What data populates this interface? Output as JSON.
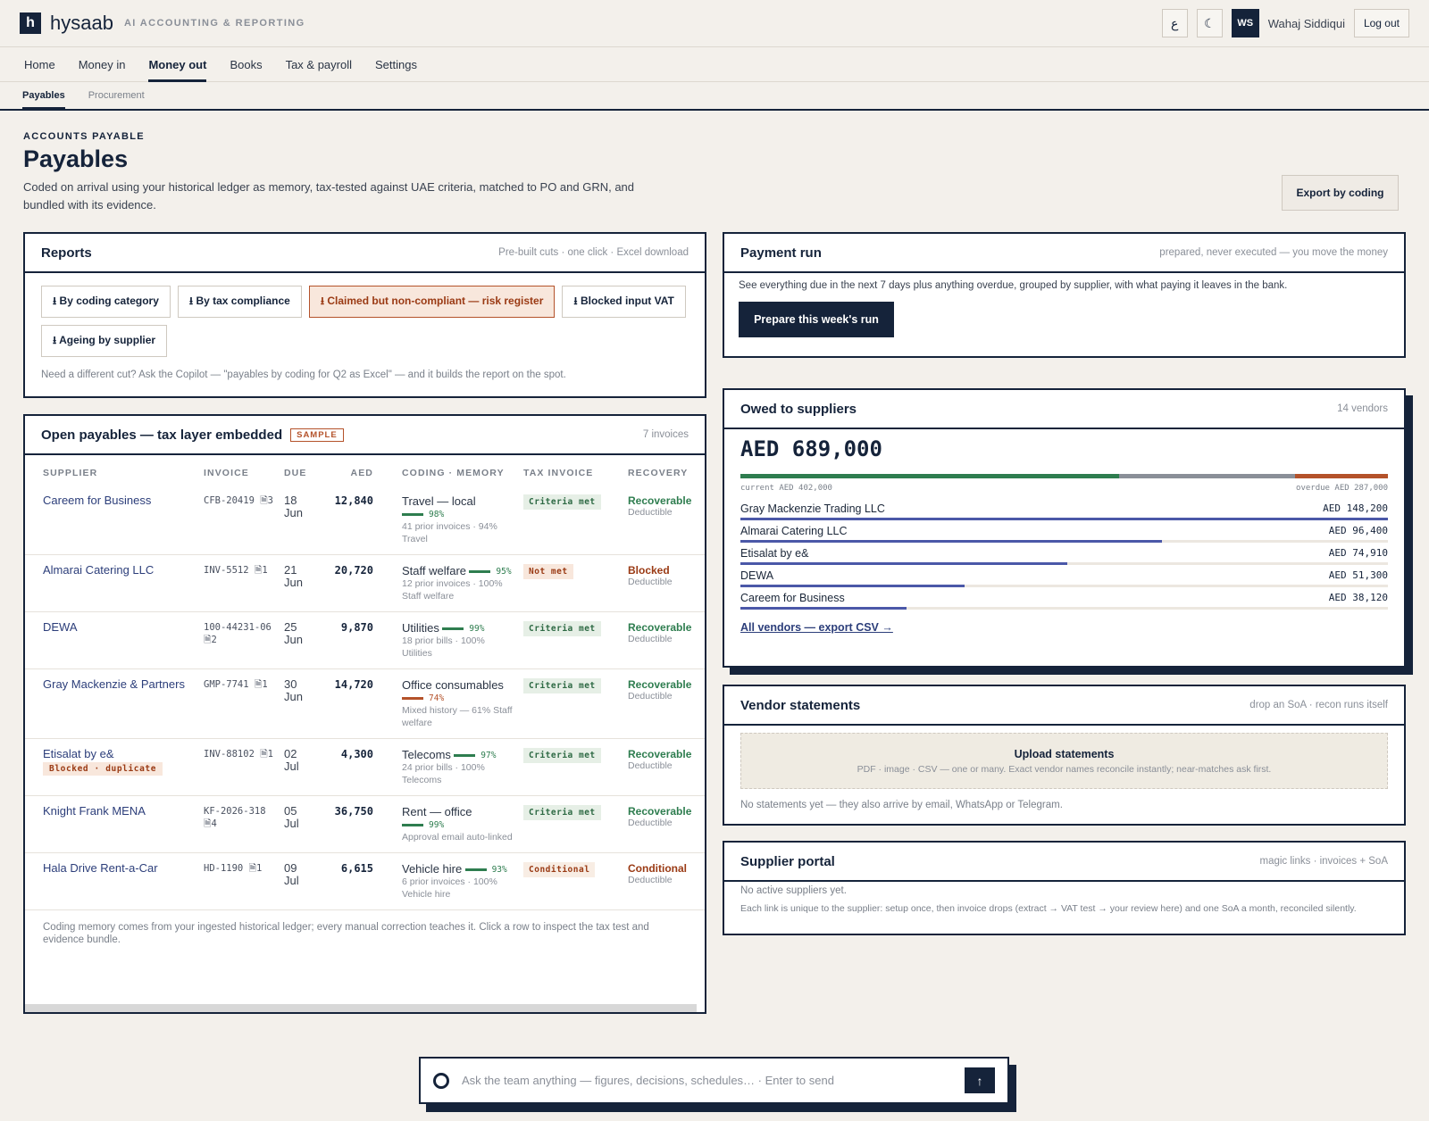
{
  "app": {
    "logo_letter": "h",
    "name": "hysaab",
    "tagline": "AI ACCOUNTING & REPORTING",
    "lang_glyph": "ع",
    "theme_glyph": "☾",
    "user_initials": "WS",
    "user_name": "Wahaj Siddiqui",
    "logout_label": "Log out"
  },
  "nav": {
    "items": [
      {
        "label": "Home"
      },
      {
        "label": "Money in"
      },
      {
        "label": "Money out"
      },
      {
        "label": "Books"
      },
      {
        "label": "Tax & payroll"
      },
      {
        "label": "Settings"
      }
    ],
    "sub": [
      {
        "label": "Payables"
      },
      {
        "label": "Procurement"
      }
    ]
  },
  "header": {
    "eyebrow": "ACCOUNTS PAYABLE",
    "title": "Payables",
    "description": "Coded on arrival using your historical ledger as memory, tax-tested against UAE criteria, matched to PO and GRN, and bundled with its evidence.",
    "export_label": "Export by coding"
  },
  "reports": {
    "title": "Reports",
    "meta": "Pre-built cuts · one click · Excel download",
    "buttons": [
      "⭳ By coding category",
      "⭳ By tax compliance",
      "⭳ Claimed but non-compliant — risk register",
      "⭳ Blocked input VAT",
      "⭳ Ageing by supplier"
    ],
    "note": "Need a different cut? Ask the Copilot — \"payables by coding for Q2 as Excel\" — and it builds the report on the spot."
  },
  "payment_run": {
    "title": "Payment run",
    "meta": "prepared, never executed — you move the money",
    "text": "See everything due in the next 7 days plus anything overdue, grouped by supplier, with what paying it leaves in the bank.",
    "button": "Prepare this week's run"
  },
  "open_payables": {
    "title": "Open payables — tax layer embedded",
    "sample_tag": "SAMPLE",
    "meta": "7 invoices",
    "columns": [
      "SUPPLIER",
      "INVOICE",
      "DUE",
      "AED",
      "CODING · MEMORY",
      "TAX INVOICE",
      "RECOVERY"
    ],
    "rows": [
      {
        "supplier": "Careem for Business",
        "invoice": "CFB-20419",
        "attach": "🗎3",
        "due_day": "18",
        "due_mon": "Jun",
        "aed": "12,840",
        "coding": "Travel — local",
        "pct": "98%",
        "pct_value": 98,
        "memory": "41 prior invoices · 94% Travel",
        "tax": "Criteria met",
        "recovery": "Recoverable",
        "recovery_sub": "Deductible"
      },
      {
        "supplier": "Almarai Catering LLC",
        "invoice": "INV-5512",
        "attach": "🗎1",
        "due_day": "21",
        "due_mon": "Jun",
        "aed": "20,720",
        "coding": "Staff welfare",
        "pct": "95%",
        "pct_value": 95,
        "memory": "12 prior invoices · 100% Staff welfare",
        "tax": "Not met",
        "recovery": "Blocked",
        "recovery_sub": "Deductible"
      },
      {
        "supplier": "DEWA",
        "invoice": "100-44231-06",
        "attach": "🗎2",
        "due_day": "25",
        "due_mon": "Jun",
        "aed": "9,870",
        "coding": "Utilities",
        "pct": "99%",
        "pct_value": 99,
        "memory": "18 prior bills · 100% Utilities",
        "tax": "Criteria met",
        "recovery": "Recoverable",
        "recovery_sub": "Deductible"
      },
      {
        "supplier": "Gray Mackenzie & Partners",
        "invoice": "GMP-7741",
        "attach": "🗎1",
        "due_day": "30",
        "due_mon": "Jun",
        "aed": "14,720",
        "coding": "Office consumables",
        "pct": "74%",
        "pct_value": 74,
        "memory": "Mixed history — 61% Staff welfare",
        "tax": "Criteria met",
        "recovery": "Recoverable",
        "recovery_sub": "Deductible"
      },
      {
        "supplier": "Etisalat by e&",
        "flag": "Blocked · duplicate",
        "invoice": "INV-88102",
        "attach": "🗎1",
        "due_day": "02",
        "due_mon": "Jul",
        "aed": "4,300",
        "coding": "Telecoms",
        "pct": "97%",
        "pct_value": 97,
        "memory": "24 prior bills · 100% Telecoms",
        "tax": "Criteria met",
        "recovery": "Recoverable",
        "recovery_sub": "Deductible"
      },
      {
        "supplier": "Knight Frank MENA",
        "invoice": "KF-2026-318",
        "attach": "🗎4",
        "due_day": "05",
        "due_mon": "Jul",
        "aed": "36,750",
        "coding": "Rent — office",
        "pct": "99%",
        "pct_value": 99,
        "memory": "Approval email auto-linked",
        "tax": "Criteria met",
        "recovery": "Recoverable",
        "recovery_sub": "Deductible"
      },
      {
        "supplier": "Hala Drive Rent-a-Car",
        "invoice": "HD-1190",
        "attach": "🗎1",
        "due_day": "09",
        "due_mon": "Jul",
        "aed": "6,615",
        "coding": "Vehicle hire",
        "pct": "93%",
        "pct_value": 93,
        "memory": "6 prior invoices · 100% Vehicle hire",
        "tax": "Conditional",
        "recovery": "Conditional",
        "recovery_sub": "Deductible"
      }
    ],
    "footnote": "Coding memory comes from your ingested historical ledger; every manual correction teaches it. Click a row to inspect the tax test and evidence bundle."
  },
  "owed": {
    "title": "Owed to suppliers",
    "meta": "14 vendors",
    "total": "AED 689,000",
    "current_label": "current AED 402,000",
    "overdue_label": "overdue AED 287,000",
    "current_value": 402000,
    "overdue_value": 287000,
    "vendors": [
      {
        "name": "Gray Mackenzie Trading LLC",
        "amount": "AED 148,200",
        "value": 148200
      },
      {
        "name": "Almarai Catering LLC",
        "amount": "AED 96,400",
        "value": 96400
      },
      {
        "name": "Etisalat by e&",
        "amount": "AED 74,910",
        "value": 74910
      },
      {
        "name": "DEWA",
        "amount": "AED 51,300",
        "value": 51300
      },
      {
        "name": "Careem for Business",
        "amount": "AED 38,120",
        "value": 38120
      }
    ],
    "link": "All vendors — export CSV →"
  },
  "statements": {
    "title": "Vendor statements",
    "meta": "drop an SoA · recon runs itself",
    "upload_title": "Upload statements",
    "upload_sub": "PDF · image · CSV — one or many. Exact vendor names reconcile instantly; near-matches ask first.",
    "empty": "No statements yet — they also arrive by email, WhatsApp or Telegram."
  },
  "portal": {
    "title": "Supplier portal",
    "meta": "magic links · invoices + SoA",
    "empty": "No active suppliers yet.",
    "note": "Each link is unique to the supplier: setup once, then invoice drops (extract → VAT test → your review here) and one SoA a month, reconciled silently."
  },
  "composer": {
    "placeholder": "Ask the team anything — figures, decisions, schedules…  ·  Enter to send",
    "send": "↑"
  },
  "colors": {
    "navy": "#15233a",
    "green": "#2e7d4f",
    "orange": "#b4522a",
    "grey": "#8a8f98",
    "indigo": "#4b58a8"
  }
}
